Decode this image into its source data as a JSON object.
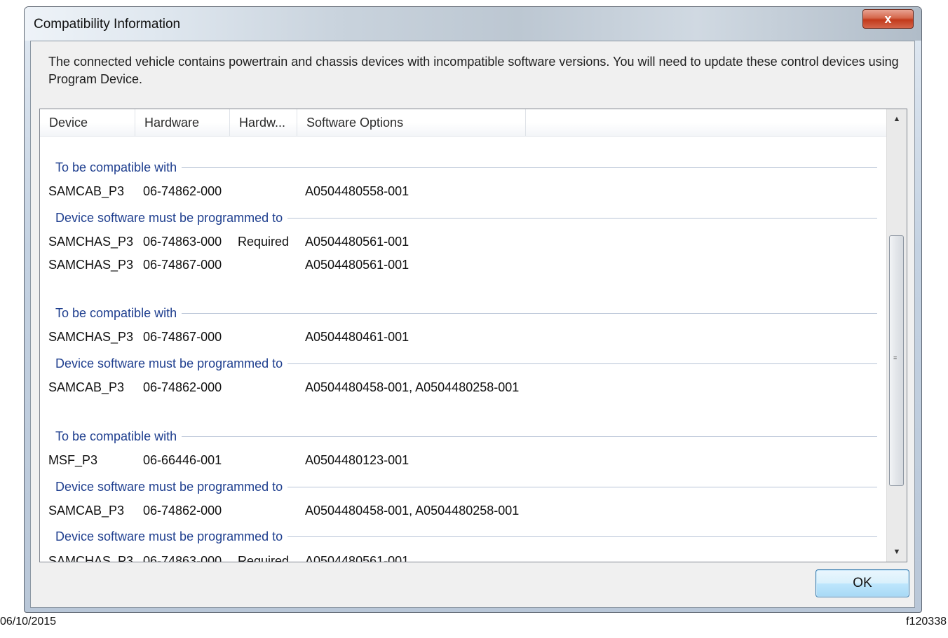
{
  "window": {
    "title": "Compatibility Information",
    "close_glyph": "x"
  },
  "message": "The connected vehicle contains powertrain and chassis devices with incompatible software versions.  You will need to update these control devices using Program Device.",
  "columns": [
    "Device",
    "Hardware",
    "Hardw...",
    "Software Options",
    ""
  ],
  "groups": [
    "To be compatible with",
    "Device software must be programmed to",
    "To be compatible with",
    "Device software must be programmed to",
    "To be compatible with",
    "Device software must be programmed to",
    "Device software must be programmed to"
  ],
  "rows": [
    {
      "device": "SAMCAB_P3",
      "hardware": "06-74862-000",
      "hw_status": "",
      "software": "A0504480558-001"
    },
    {
      "device": "SAMCHAS_P3",
      "hardware": "06-74863-000",
      "hw_status": "Required",
      "software": "A0504480561-001"
    },
    {
      "device": "SAMCHAS_P3",
      "hardware": "06-74867-000",
      "hw_status": "",
      "software": "A0504480561-001"
    },
    {
      "device": "SAMCHAS_P3",
      "hardware": "06-74867-000",
      "hw_status": "",
      "software": "A0504480461-001"
    },
    {
      "device": "SAMCAB_P3",
      "hardware": "06-74862-000",
      "hw_status": "",
      "software": "A0504480458-001, A0504480258-001"
    },
    {
      "device": "MSF_P3",
      "hardware": "06-66446-001",
      "hw_status": "",
      "software": "A0504480123-001"
    },
    {
      "device": "SAMCAB_P3",
      "hardware": "06-74862-000",
      "hw_status": "",
      "software": "A0504480458-001, A0504480258-001"
    },
    {
      "device": "SAMCHAS_P3",
      "hardware": "06-74863-000",
      "hw_status": "Required",
      "software": "A0504480561-001"
    }
  ],
  "scrollbar": {
    "up_glyph": "▲",
    "down_glyph": "▼",
    "grip_glyph": "≡"
  },
  "buttons": {
    "ok": "OK"
  },
  "footer": {
    "date": "06/10/2015",
    "figure_id": "f120338"
  },
  "icons": {
    "close": "close-icon",
    "scroll_up": "scroll-up-arrow-icon",
    "scroll_down": "scroll-down-arrow-icon"
  },
  "colors": {
    "group_header_text": "#1f3f8f",
    "close_button": "#c2391b",
    "ok_button_border": "#3c7fb1"
  }
}
